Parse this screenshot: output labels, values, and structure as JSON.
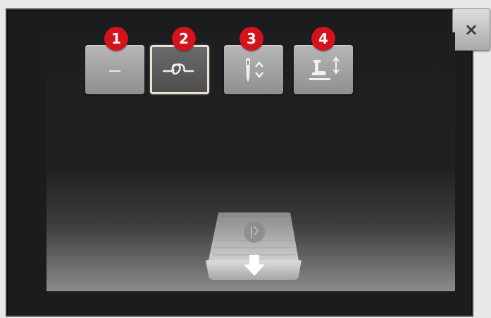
{
  "window": {
    "close_label": "×"
  },
  "toolbar": {
    "buttons": [
      {
        "name": "single-stitch",
        "icon": "dash-icon",
        "badge": "1",
        "active": false
      },
      {
        "name": "securing-knot",
        "icon": "knot-icon",
        "badge": "2",
        "active": true
      },
      {
        "name": "needle-position",
        "icon": "needle-up-down-icon",
        "badge": "3",
        "active": false
      },
      {
        "name": "presser-foot",
        "icon": "presser-foot-up-down-icon",
        "badge": "4",
        "active": false
      }
    ]
  },
  "colors": {
    "badge": "#d3141d",
    "frame": "#1b1c1e",
    "button": "#a3a3a3",
    "active_border": "#ece3d2"
  }
}
